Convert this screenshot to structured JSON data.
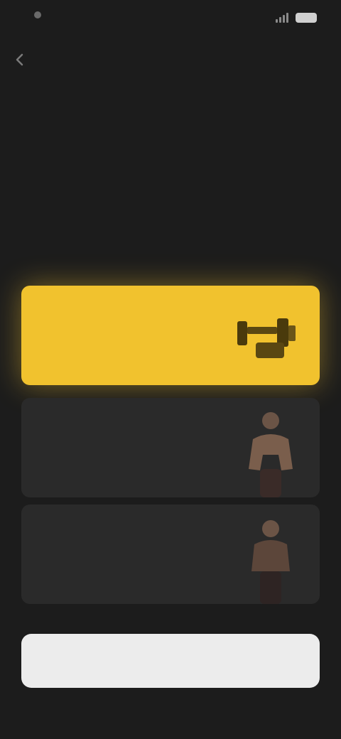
{
  "status_bar": {
    "time": "",
    "battery_color": "#d0d0d0"
  },
  "header": {
    "back_icon": "chevron-left-icon"
  },
  "page": {
    "title": "",
    "subtitle": ""
  },
  "workouts": [
    {
      "name": "",
      "description": "",
      "selected": true,
      "icon": "dumbbell-icon"
    },
    {
      "name": "",
      "description": "",
      "selected": false,
      "icon": "person-figure"
    },
    {
      "name": "",
      "description": "",
      "selected": false,
      "icon": "person-figure"
    }
  ],
  "cta": {
    "label": ""
  },
  "colors": {
    "accent": "#f1c22e",
    "background": "#1c1c1c",
    "card": "#2a2a2a"
  }
}
